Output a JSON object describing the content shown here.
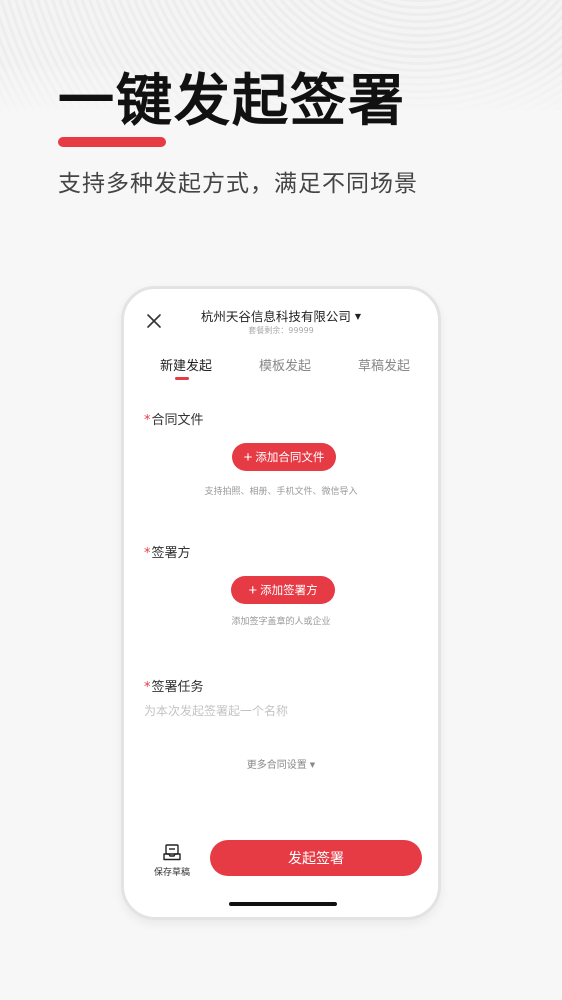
{
  "promo": {
    "headline": "一键发起签署",
    "subhead": "支持多种发起方式，满足不同场景"
  },
  "header": {
    "company": "杭州天谷信息科技有限公司",
    "quota_label": "套餐剩余：",
    "quota_value": "99999"
  },
  "tabs": [
    {
      "label": "新建发起",
      "active": true
    },
    {
      "label": "模板发起",
      "active": false
    },
    {
      "label": "草稿发起",
      "active": false
    }
  ],
  "contract_file": {
    "label": "合同文件",
    "button": "添加合同文件",
    "hint": "支持拍照、相册、手机文件、微信导入"
  },
  "signers": {
    "label": "签署方",
    "button": "添加签署方",
    "hint": "添加签字盖章的人或企业"
  },
  "task": {
    "label": "签署任务",
    "placeholder": "为本次发起签署起一个名称",
    "value": ""
  },
  "more_settings": "更多合同设置",
  "footer": {
    "save_draft": "保存草稿",
    "submit": "发起签署"
  },
  "colors": {
    "accent": "#e63a45",
    "background": "#f7f7f7"
  },
  "icons": {
    "close": "close-icon",
    "dropdown": "caret-down-icon",
    "plus": "plus-icon",
    "save_draft": "inbox-tray-icon"
  }
}
